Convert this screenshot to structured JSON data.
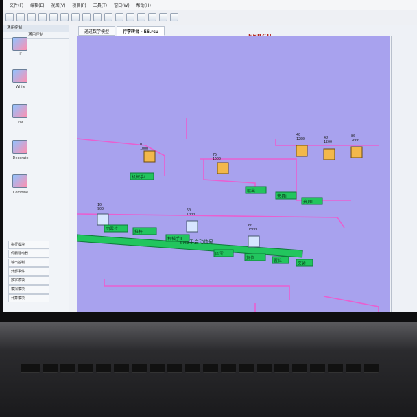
{
  "window": {
    "menu": [
      "文件(F)",
      "编辑(E)",
      "视图(V)",
      "项目(P)",
      "工具(T)",
      "窗口(W)",
      "帮助(H)"
    ],
    "device_label": "E6RCU"
  },
  "tabs": [
    {
      "label": "通过数学模型"
    },
    {
      "label": "行李转台 - E6.rcu"
    }
  ],
  "left_panel": {
    "title": "通用控制",
    "subtitle": "通用控制",
    "tools": [
      {
        "label": "If"
      },
      {
        "label": "While"
      },
      {
        "label": "For"
      },
      {
        "label": "Decorate"
      },
      {
        "label": "Combine"
      }
    ],
    "categories": [
      "执行模块",
      "伺服驱动器",
      "输出控制",
      "外部事件",
      "数字模块",
      "模拟模块",
      "计算模块"
    ]
  },
  "canvas": {
    "nodes": [
      {
        "id": "n1",
        "label": "机械手I",
        "value": "0.1",
        "label2": "1000"
      },
      {
        "id": "n2",
        "label": "取出",
        "value": "75",
        "label2": "1500"
      },
      {
        "id": "n3",
        "label": "夹具I",
        "value": "40",
        "label2": "1200"
      },
      {
        "id": "n4",
        "label": "夹具II",
        "value": "40",
        "label2": "1200"
      },
      {
        "id": "n5",
        "label": "夹具III",
        "value": "80",
        "label2": "2000"
      },
      {
        "id": "n6",
        "label": "回零",
        "value": "10",
        "label2": "900"
      },
      {
        "id": "n7",
        "label": "回零位",
        "value": "60",
        "label2": "1500"
      },
      {
        "id": "n8",
        "label": "推杆",
        "value": "50",
        "label2": "1000"
      }
    ],
    "tags": [
      "机械手I",
      "取出",
      "夹具I",
      "夹具II",
      "回零位",
      "推杆",
      "回零",
      "机械手II",
      "复位",
      "置位",
      "夹紧"
    ],
    "flow_banner": "机械手启动信号"
  },
  "colors": {
    "canvas_bg": "#a8a2ee",
    "wire": "#e95fd0",
    "tag_bg": "#22c55e",
    "accent_red": "#b3261e"
  }
}
